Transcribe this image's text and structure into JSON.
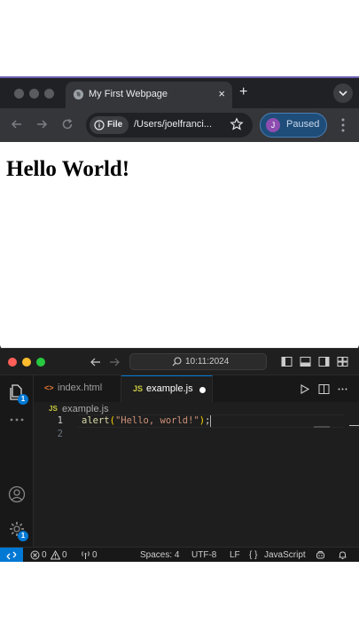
{
  "browser": {
    "tab_title": "My First Webpage",
    "tab_close": "×",
    "new_tab": "+",
    "chip_label": "File",
    "url": "/Users/joelfranci...",
    "profile_initial": "J",
    "profile_status": "Paused",
    "page": {
      "heading": "Hello World!"
    }
  },
  "vscode": {
    "command_center": "10:11:2024",
    "tabs": [
      {
        "icon": "<>",
        "label": "index.html",
        "active": false
      },
      {
        "icon": "JS",
        "label": "example.js",
        "active": true,
        "dirty": true
      }
    ],
    "breadcrumb": {
      "icon": "JS",
      "label": "example.js"
    },
    "lines": [
      {
        "number": "1",
        "tokens": [
          {
            "text": "alert",
            "color": "#dcdcaa"
          },
          {
            "text": "(",
            "color": "#ffd700"
          },
          {
            "text": "\"Hello, world!\"",
            "color": "#ce9178"
          },
          {
            "text": ")",
            "color": "#ffd700"
          },
          {
            "text": ";",
            "color": "#d4d4d4"
          }
        ]
      },
      {
        "number": "2",
        "tokens": []
      }
    ],
    "badges": {
      "explorer": "1",
      "settings": "1"
    },
    "status": {
      "errors": "0",
      "warnings": "0",
      "ports": "0",
      "spaces": "Spaces: 4",
      "encoding": "UTF-8",
      "eol": "LF",
      "language_braces": "{ }",
      "language": "JavaScript"
    }
  },
  "colors": {
    "accent": "#0078d4",
    "js_icon": "#cbcb41",
    "html_icon": "#e37933",
    "close_red": "#ff5f57",
    "minimize_yellow": "#febc2e",
    "zoom_green": "#28c840"
  }
}
